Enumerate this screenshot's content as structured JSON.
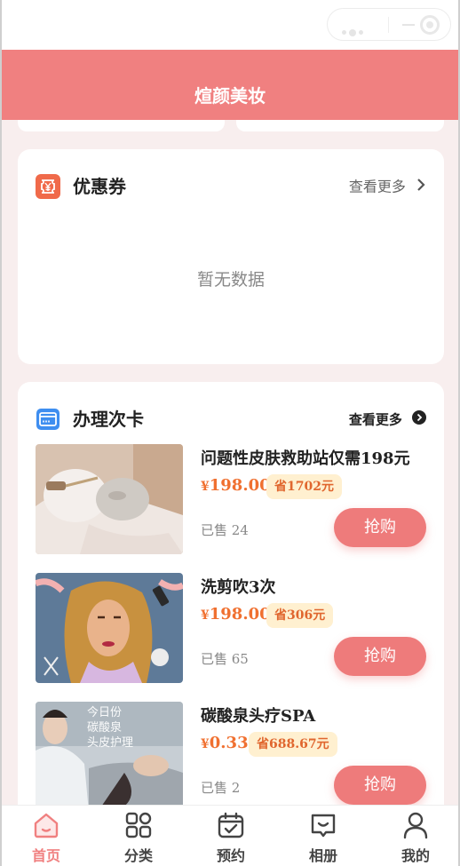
{
  "app": {
    "title": "煊颜美妆"
  },
  "coupons": {
    "title": "优惠券",
    "more_label": "查看更多",
    "empty_text": "暂无数据"
  },
  "cards": {
    "title": "办理次卡",
    "more_label": "查看更多",
    "items": [
      {
        "name": "问题性皮肤救助站仅需198元",
        "currency": "¥",
        "price": "198.00",
        "save": "省1702元",
        "sold": "已售 24",
        "buy_label": "抢购",
        "image": "facial-mask-photo"
      },
      {
        "name": "洗剪吹3次",
        "currency": "¥",
        "price": "198.00",
        "save": "省306元",
        "sold": "已售 65",
        "buy_label": "抢购",
        "image": "hair-salon-illustration"
      },
      {
        "name": "碳酸泉头疗SPA",
        "currency": "¥",
        "price": "0.33",
        "save": "省688.67元",
        "sold": "已售 2",
        "buy_label": "抢购",
        "image": "head-spa-photo",
        "image_caption": [
          "今日份",
          "碳酸泉",
          "头皮护理"
        ]
      }
    ]
  },
  "tabbar": {
    "items": [
      {
        "label": "首页",
        "icon": "home-icon",
        "active": true
      },
      {
        "label": "分类",
        "icon": "grid-icon",
        "active": false
      },
      {
        "label": "预约",
        "icon": "calendar-icon",
        "active": false
      },
      {
        "label": "相册",
        "icon": "album-icon",
        "active": false
      },
      {
        "label": "我的",
        "icon": "user-icon",
        "active": false
      }
    ]
  },
  "colors": {
    "brand": "#f08080",
    "price": "#f07030",
    "background": "#f8eeee"
  }
}
